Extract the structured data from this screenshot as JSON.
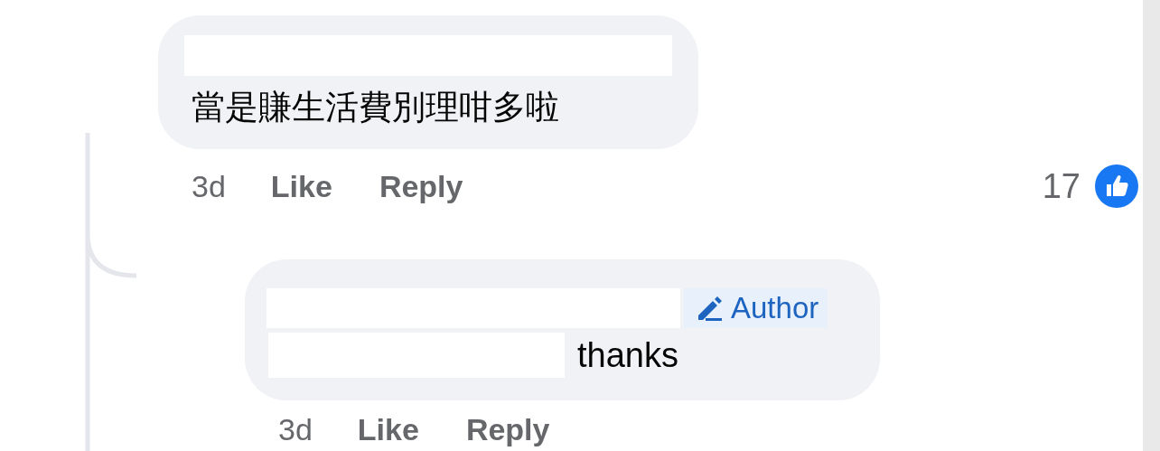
{
  "comments": [
    {
      "text": "當是賺生活費別理咁多啦",
      "time": "3d",
      "like": "Like",
      "reply": "Reply",
      "reaction_count": "17",
      "replies": [
        {
          "author_badge": "Author",
          "text": "thanks",
          "time": "3d",
          "like": "Like",
          "reply": "Reply"
        }
      ]
    }
  ]
}
